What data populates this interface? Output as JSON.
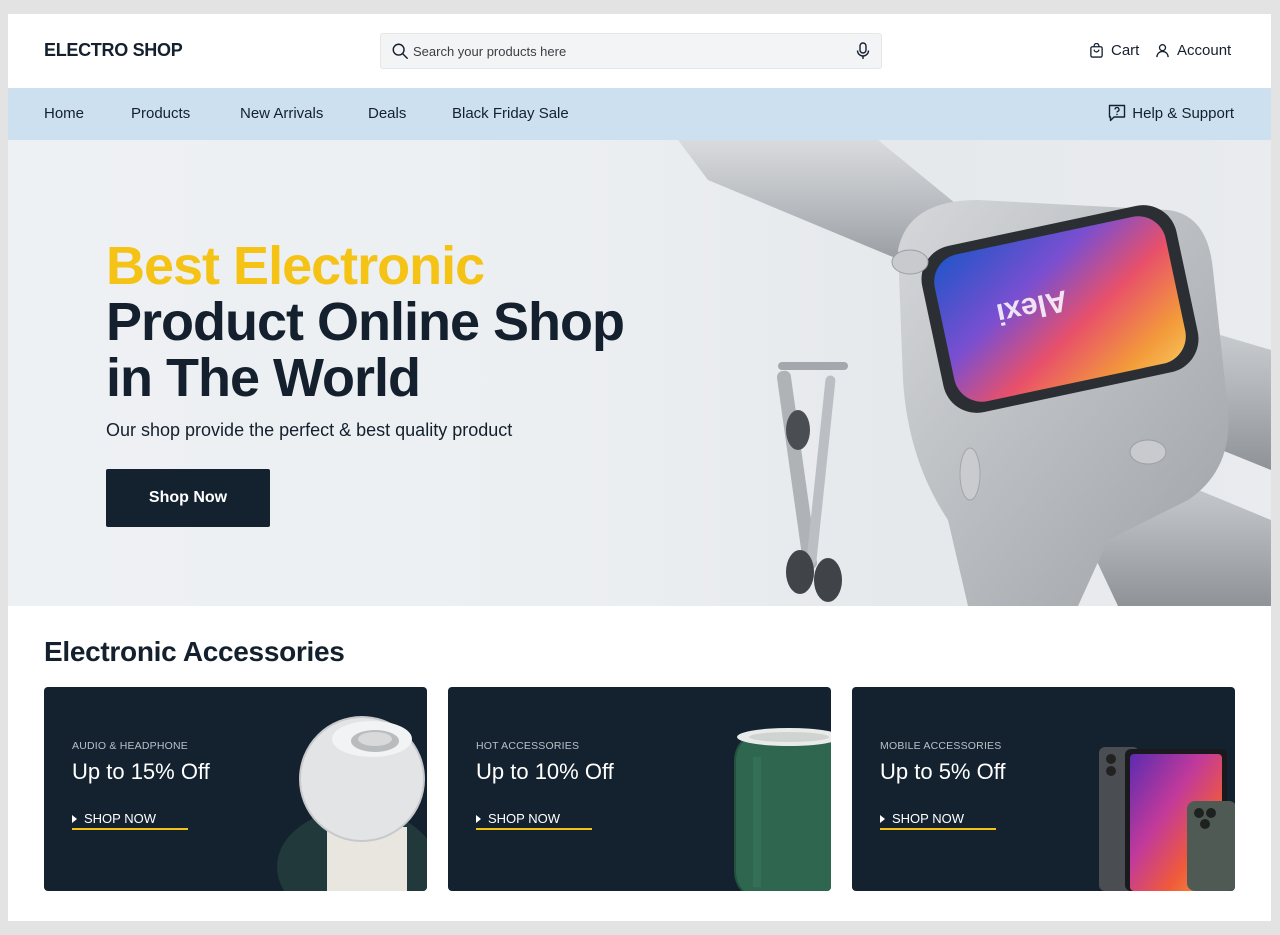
{
  "header": {
    "logo": "ELECTRO SHOP",
    "search_placeholder": "Search your products here",
    "cart_label": "Cart",
    "account_label": "Account"
  },
  "nav": {
    "items": [
      "Home",
      "Products",
      "New Arrivals",
      "Deals",
      "Black Friday Sale"
    ],
    "help_label": "Help & Support"
  },
  "hero": {
    "title_line1": "Best Electronic",
    "title_line2": "Product Online Shop",
    "title_line3": "in The World",
    "subtitle": "Our shop provide  the perfect & best quality product",
    "button_label": "Shop Now",
    "screen_text": "Alexi"
  },
  "accessories": {
    "title": "Electronic Accessories",
    "cards": [
      {
        "category": "AUDIO & HEADPHONE",
        "offer": "Up to 15% Off",
        "cta": "SHOP NOW",
        "icon": "smart-speaker"
      },
      {
        "category": "HOT ACCESSORIES",
        "offer": "Up to 10% Off",
        "cta": "SHOP NOW",
        "icon": "cylinder-speaker"
      },
      {
        "category": "MOBILE ACCESSORIES",
        "offer": "Up to 5% Off",
        "cta": "SHOP NOW",
        "icon": "tablet-and-phone"
      }
    ]
  },
  "colors": {
    "accent_yellow": "#f5c315",
    "dark_navy": "#14222f",
    "nav_bg": "#cde0ef",
    "page_bg": "#e3e3e3"
  }
}
